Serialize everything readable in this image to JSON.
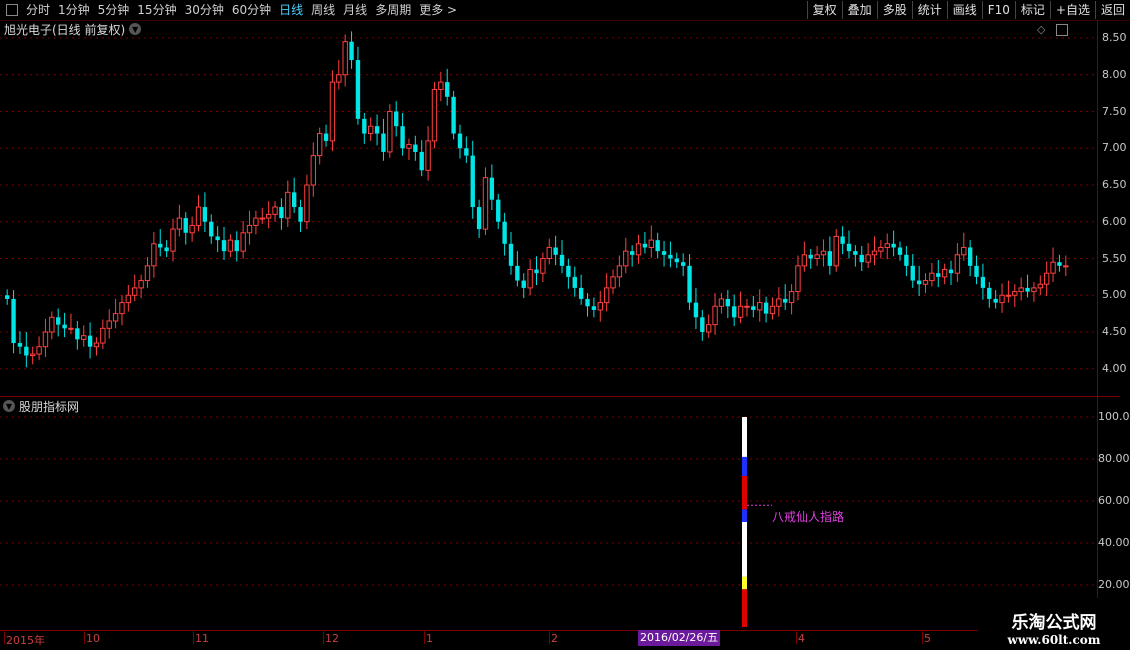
{
  "toolbar": {
    "periods": [
      "分时",
      "1分钟",
      "5分钟",
      "15分钟",
      "30分钟",
      "60分钟",
      "日线",
      "周线",
      "月线",
      "多周期",
      "更多 >"
    ],
    "active_period": "日线",
    "actions": [
      "复权",
      "叠加",
      "多股",
      "统计",
      "画线",
      "F10",
      "标记",
      "+自选",
      "返回"
    ]
  },
  "stock": {
    "title": "旭光电子(日线 前复权)"
  },
  "indicator": {
    "title": "股朋指标网",
    "annotation": "八戒仙人指路"
  },
  "timeline": {
    "labels": [
      "2015年",
      "10",
      "11",
      "12",
      "1",
      "2",
      "4",
      "5"
    ],
    "highlight": "2016/02/26/五"
  },
  "watermark": {
    "line1": "乐淘公式网",
    "line2": "www.60lt.com"
  },
  "colors": {
    "up": "#ff4040",
    "down": "#00e5e5",
    "grid": "#7a0000",
    "annotation": "#e040e0"
  },
  "chart_data": [
    {
      "type": "candlestick",
      "y_ticks": [
        "8.50",
        "8.00",
        "7.50",
        "7.00",
        "6.50",
        "6.00",
        "5.50",
        "5.00",
        "4.50",
        "4.00"
      ],
      "ylim": [
        3.85,
        8.5
      ],
      "close_values": [
        4.95,
        4.35,
        4.3,
        4.18,
        4.2,
        4.3,
        4.5,
        4.7,
        4.6,
        4.55,
        4.55,
        4.4,
        4.45,
        4.3,
        4.35,
        4.55,
        4.65,
        4.75,
        4.9,
        5.0,
        5.1,
        5.2,
        5.4,
        5.7,
        5.65,
        5.6,
        5.9,
        6.05,
        5.85,
        5.95,
        6.2,
        6.0,
        5.8,
        5.75,
        5.6,
        5.75,
        5.6,
        5.85,
        5.95,
        6.05,
        6.05,
        6.1,
        6.2,
        6.05,
        6.4,
        6.2,
        6.0,
        6.5,
        6.9,
        7.2,
        7.1,
        7.9,
        8.0,
        8.45,
        8.2,
        7.4,
        7.2,
        7.3,
        7.2,
        6.95,
        7.5,
        7.3,
        7.0,
        7.05,
        6.95,
        6.7,
        7.1,
        7.8,
        7.9,
        7.7,
        7.2,
        7.0,
        6.9,
        6.2,
        5.9,
        6.6,
        6.3,
        6.0,
        5.7,
        5.4,
        5.2,
        5.1,
        5.35,
        5.3,
        5.5,
        5.65,
        5.55,
        5.4,
        5.25,
        5.1,
        4.95,
        4.85,
        4.8,
        4.9,
        5.1,
        5.25,
        5.4,
        5.6,
        5.55,
        5.7,
        5.65,
        5.75,
        5.6,
        5.55,
        5.5,
        5.45,
        5.4,
        4.9,
        4.7,
        4.5,
        4.6,
        4.85,
        4.95,
        4.85,
        4.7,
        4.85,
        4.85,
        4.8,
        4.9,
        4.75,
        4.85,
        4.95,
        4.9,
        5.05,
        5.4,
        5.55,
        5.5,
        5.55,
        5.6,
        5.4,
        5.8,
        5.7,
        5.6,
        5.55,
        5.45,
        5.55,
        5.6,
        5.65,
        5.7,
        5.65,
        5.55,
        5.4,
        5.2,
        5.15,
        5.2,
        5.3,
        5.25,
        5.35,
        5.3,
        5.55,
        5.65,
        5.4,
        5.25,
        5.1,
        4.95,
        4.9,
        5.0,
        5.0,
        5.05,
        5.1,
        5.05,
        5.1,
        5.15,
        5.3,
        5.45,
        5.4,
        5.4
      ]
    },
    {
      "type": "bar",
      "y_ticks": [
        "100.0",
        "80.00",
        "60.00",
        "40.00",
        "20.00"
      ],
      "ylim": [
        0,
        100
      ],
      "segments": [
        {
          "from": 0,
          "to": 18,
          "color": "red"
        },
        {
          "from": 18,
          "to": 24,
          "color": "yellow"
        },
        {
          "from": 24,
          "to": 50,
          "color": "white"
        },
        {
          "from": 50,
          "to": 56,
          "color": "blue"
        },
        {
          "from": 56,
          "to": 72,
          "color": "red"
        },
        {
          "from": 72,
          "to": 81,
          "color": "blue"
        },
        {
          "from": 81,
          "to": 100,
          "color": "white"
        }
      ],
      "marker_value": 58
    }
  ]
}
